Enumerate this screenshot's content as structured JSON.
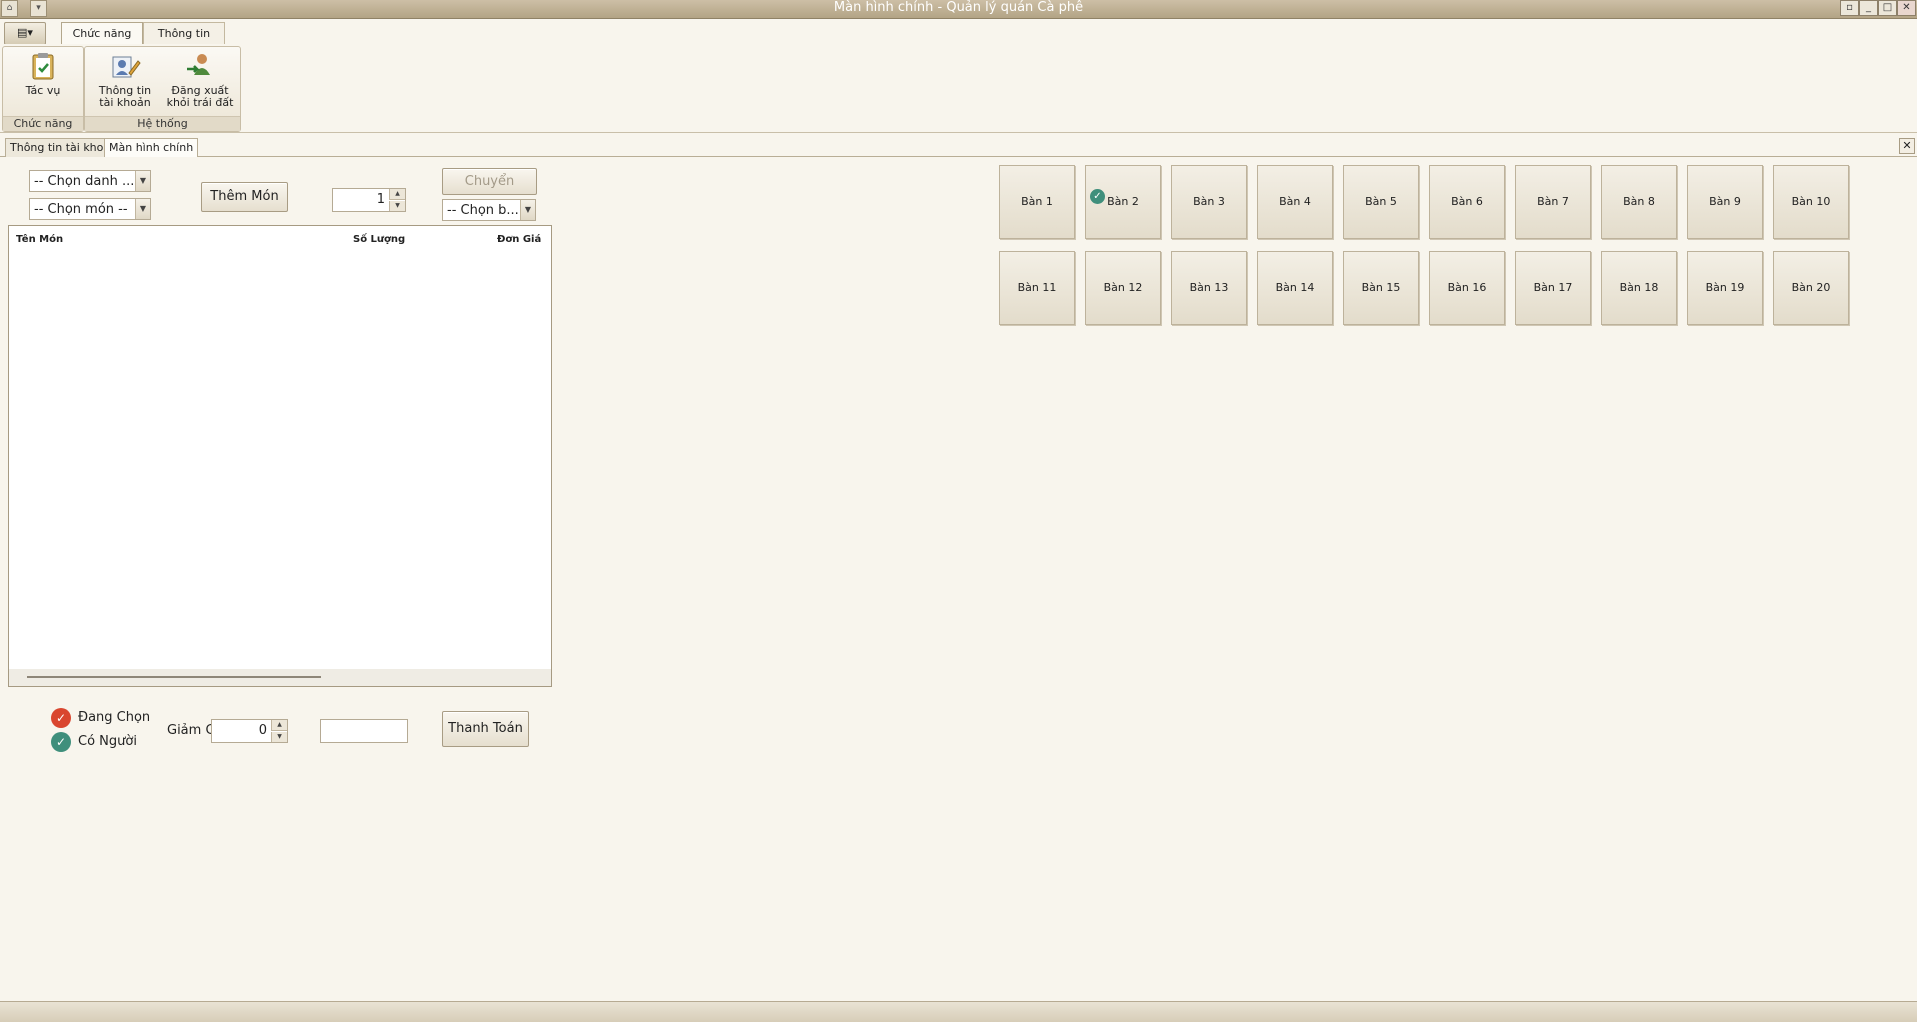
{
  "window": {
    "title": "Màn hình chính - Quản lý quán Cà phê",
    "controls": [
      "restore-icon",
      "minimize-icon",
      "maximize-icon",
      "close-icon"
    ]
  },
  "ribbon": {
    "tabs": [
      "Chức năng",
      "Thông tin"
    ],
    "active_tab": "Chức năng",
    "groups": [
      {
        "label": "Chức năng",
        "buttons": [
          {
            "label": "Tác vụ",
            "icon": "clipboard-check-icon"
          }
        ]
      },
      {
        "label": "Hệ thống",
        "buttons": [
          {
            "line1": "Thông tin",
            "line2": "tài khoản",
            "icon": "user-edit-icon"
          },
          {
            "line1": "Đăng xuất",
            "line2": "khỏi trái đất",
            "icon": "user-logout-icon"
          }
        ]
      }
    ]
  },
  "doc_tabs": {
    "items": [
      "Thông tin tài khoản",
      "Màn hình chính"
    ],
    "active": "Màn hình chính"
  },
  "order": {
    "category_combo": "-- Chọn danh ...",
    "food_combo": "-- Chọn món --",
    "add_button": "Thêm Món",
    "quantity": "1",
    "switch_button": "Chuyển",
    "switch_combo": "-- Chọn b...",
    "columns": [
      "Tên Món",
      "Số Lượng",
      "Đơn Giá"
    ]
  },
  "legend": {
    "selecting": "Đang Chọn",
    "occupied": "Có Người"
  },
  "payment": {
    "discount_label": "Giảm Giá",
    "discount_value": "0",
    "total_value": "",
    "pay_button": "Thanh Toán"
  },
  "tables": {
    "row1": [
      "Bàn 1",
      "Bàn 2",
      "Bàn 3",
      "Bàn 4",
      "Bàn 5",
      "Bàn 6",
      "Bàn 7",
      "Bàn 8",
      "Bàn 9",
      "Bàn 10"
    ],
    "row2": [
      "Bàn 11",
      "Bàn 12",
      "Bàn 13",
      "Bàn 14",
      "Bàn 15",
      "Bàn 16",
      "Bàn 17",
      "Bàn 18",
      "Bàn 19",
      "Bàn 20"
    ],
    "occupied": [
      "Bàn 2"
    ]
  },
  "colors": {
    "occupied": "#3f8f7c",
    "selecting": "#d9462f",
    "background": "#f8f5ed"
  }
}
